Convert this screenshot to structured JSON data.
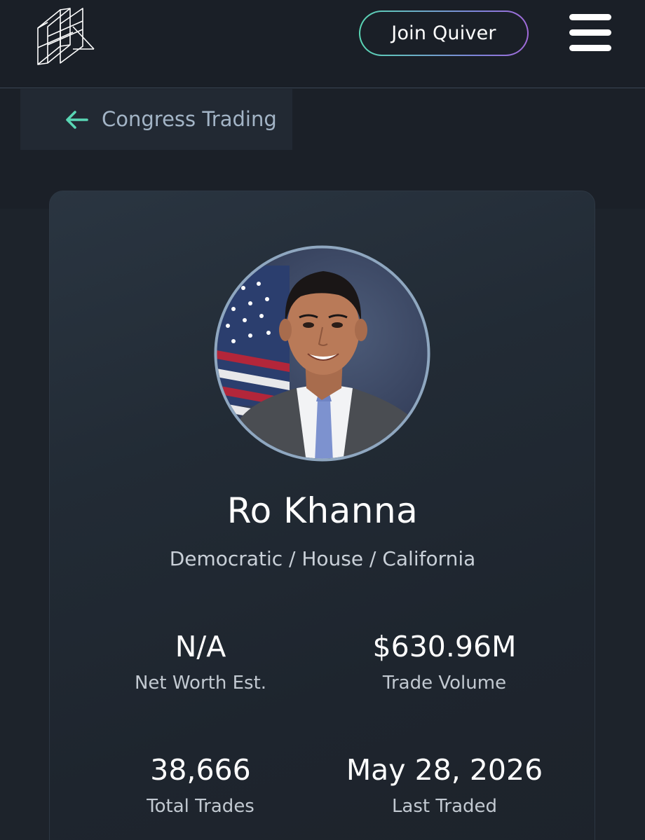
{
  "header": {
    "logo_icon": "quiver-logo-icon",
    "join_button_label": "Join Quiver",
    "menu_icon": "hamburger-menu-icon"
  },
  "back_link": {
    "icon": "arrow-left-icon",
    "label": "Congress Trading"
  },
  "profile": {
    "photo": "member-portrait",
    "name": "Ro Khanna",
    "subtitle": "Democratic / House / California",
    "stats": [
      {
        "value": "N/A",
        "label": "Net Worth Est."
      },
      {
        "value": "$630.96M",
        "label": "Trade Volume"
      },
      {
        "value": "38,666",
        "label": "Total Trades"
      },
      {
        "value": "May 28, 2026",
        "label": "Last Traded"
      }
    ]
  },
  "colors": {
    "background": "#1b2028",
    "accent_teal": "#59d6b4",
    "accent_purple": "#a16ad9",
    "back_link_text": "#a3b4c6"
  }
}
